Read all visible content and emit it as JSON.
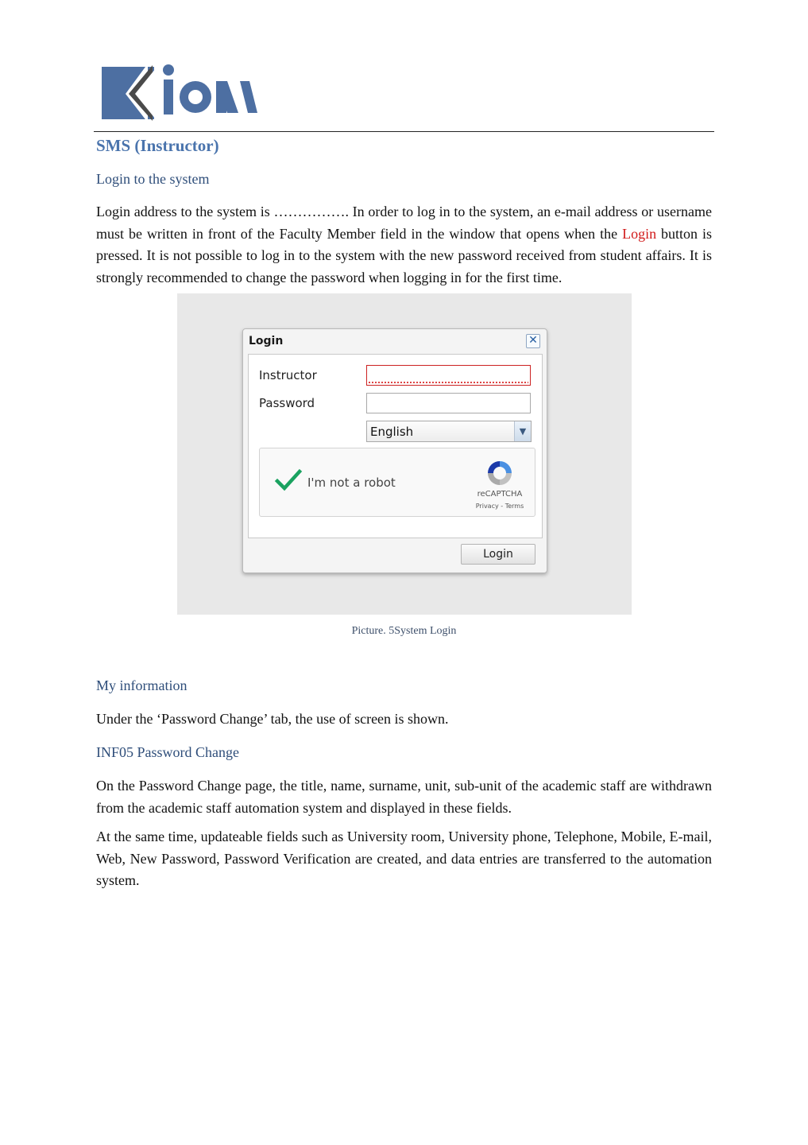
{
  "header": {
    "logo_text": "Kion"
  },
  "section_title": "SMS (Instructor)",
  "login_section": {
    "heading": "Login to the system",
    "paragraph_before": "Login address to the system is ……………. In order to log in to the system, an e-mail address or username must be written in front of the Faculty Member field in the window that opens when the ",
    "paragraph_link": "Login",
    "paragraph_after": " button is pressed. It is not possible to log in to the system with the new password received from student affairs. It is strongly recommended to change the password when logging in for the first time."
  },
  "login_dialog": {
    "title": "Login",
    "instructor_label": "Instructor",
    "instructor_value": "",
    "password_label": "Password",
    "password_value": "",
    "language_selected": "English",
    "captcha_text": "I'm not a robot",
    "captcha_brand": "reCAPTCHA",
    "captcha_links": "Privacy - Terms",
    "login_button": "Login",
    "colors": {
      "error_border": "#cc2222",
      "check": "#1aa260"
    }
  },
  "figure_caption": "Picture. 5System Login",
  "my_information": {
    "heading": "My information",
    "paragraph": "Under the ‘Password Change’ tab, the use of screen is shown."
  },
  "password_change": {
    "heading": "INF05 Password Change",
    "paragraph1": "On the Password Change page, the title, name, surname, unit, sub-unit of the academic staff are withdrawn from the academic staff automation system and displayed in these fields.",
    "paragraph2": "At the same time, updateable fields such as University room, University phone, Telephone, Mobile, E-mail, Web, New Password, Password Verification are created, and data entries are transferred to the automation system."
  }
}
